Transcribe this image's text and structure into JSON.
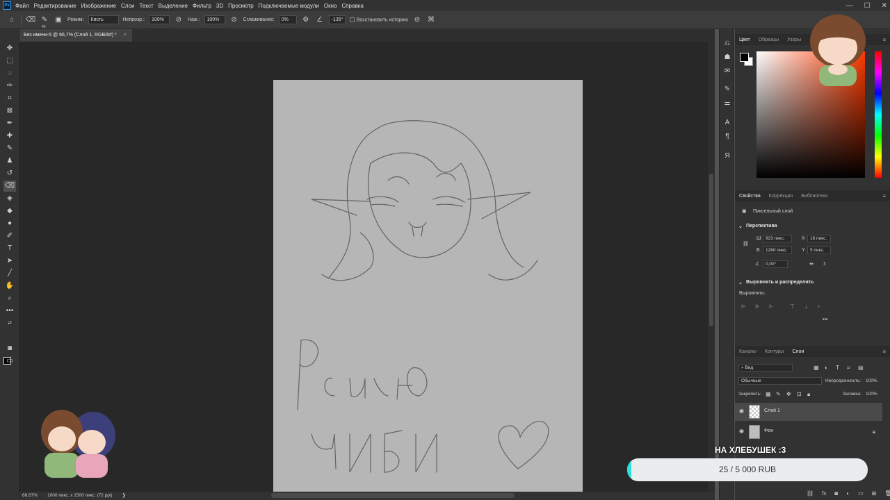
{
  "app": {
    "logo": "Ps"
  },
  "menu": [
    "Файл",
    "Редактирование",
    "Изображение",
    "Слои",
    "Текст",
    "Выделение",
    "Фильтр",
    "3D",
    "Просмотр",
    "Подключаемые модули",
    "Окно",
    "Справка"
  ],
  "window_controls": [
    "—",
    "☐",
    "✕"
  ],
  "options": {
    "brush_size": "40",
    "mode_label": "Режим:",
    "mode_value": "Кисть",
    "opacity_label": "Непрозр.:",
    "opacity_value": "100%",
    "flow_label": "Наж.:",
    "flow_value": "100%",
    "smoothing_label": "Сглаживание:",
    "smoothing_value": "0%",
    "angle_value": "-135°",
    "history_label": "Восстановить историю"
  },
  "document_tab": {
    "title": "Без имени-5 @ 66,7% (Слой 1, RGB/8#) *",
    "close": "×"
  },
  "status": {
    "zoom": "66,67%",
    "info": "1000 пикс. x 1500 пикс. (72 ppi)",
    "arrow": "❯"
  },
  "color_panel": {
    "tabs": [
      "Цвет",
      "Образцы",
      "Узоры"
    ],
    "active": 0,
    "fg": "#000000",
    "bg": "#ffffff"
  },
  "properties_panel": {
    "tabs": [
      "Свойства",
      "Коррекция",
      "Библиотеки"
    ],
    "active": 0,
    "layer_type": "Пиксельный слой",
    "transform_header": "Перспектива",
    "w_label": "Ш",
    "w_value": "923 пикс.",
    "h_label": "В",
    "h_value": "1260 пикс.",
    "x_label": "X",
    "x_value": "16 пикс.",
    "y_label": "Y",
    "y_value": "5 пикс.",
    "angle_value": "0,00°",
    "align_header": "Выровнять и распределить",
    "align_label": "Выровнять:",
    "more": "•••"
  },
  "layers_panel": {
    "tabs": [
      "Каналы",
      "Контуры",
      "Слои"
    ],
    "active": 2,
    "filter_label": "Вид",
    "blend_mode": "Обычные",
    "opacity_label": "Непрозрачность:",
    "opacity_value": "100%",
    "lock_label": "Закрепить:",
    "fill_label": "Заливка:",
    "fill_value": "100%",
    "layers": [
      {
        "name": "Слой 1",
        "selected": true
      },
      {
        "name": "Фон",
        "selected": false,
        "locked": true
      }
    ]
  },
  "overlay": {
    "donation_label": "НА ХЛЕБУШЕК :3",
    "donation_text": "25 / 5 000 RUB",
    "donation_progress": 0.005
  }
}
